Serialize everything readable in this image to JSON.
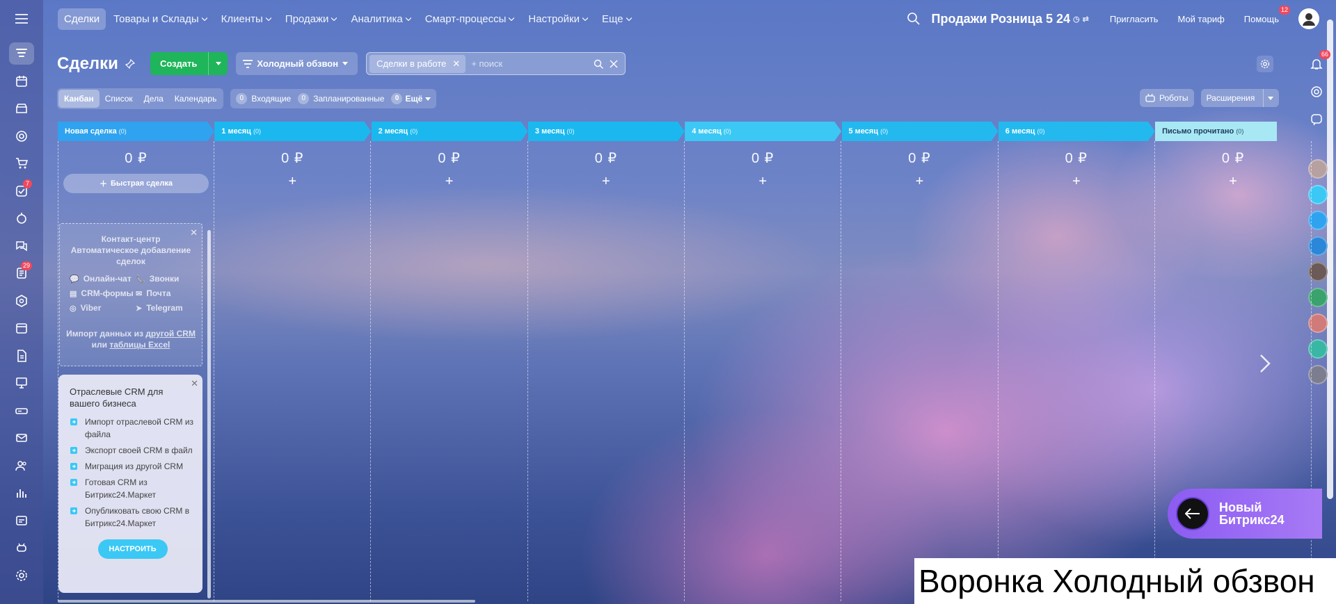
{
  "topnav": {
    "items": [
      {
        "label": "Сделки",
        "active": true,
        "dropdown": false
      },
      {
        "label": "Товары и Склады",
        "active": false,
        "dropdown": true
      },
      {
        "label": "Клиенты",
        "active": false,
        "dropdown": true
      },
      {
        "label": "Продажи",
        "active": false,
        "dropdown": true
      },
      {
        "label": "Аналитика",
        "active": false,
        "dropdown": true
      },
      {
        "label": "Смарт-процессы",
        "active": false,
        "dropdown": true
      },
      {
        "label": "Настройки",
        "active": false,
        "dropdown": true
      },
      {
        "label": "Еще",
        "active": false,
        "dropdown": true
      }
    ]
  },
  "header": {
    "portal_name": "Продажи Розница 5 24",
    "invite": "Пригласить",
    "tariff": "Мой тариф",
    "help": "Помощь",
    "help_badge": "12"
  },
  "sidebar": {
    "badges": {
      "tasks": "7",
      "feed": "29"
    }
  },
  "rightbar": {
    "notifications_badge": "66"
  },
  "page": {
    "title": "Сделки",
    "create": "Создать",
    "funnel": "Холодный обзвон",
    "filter_tag": "Сделки в работе",
    "search_placeholder": "+ поиск"
  },
  "views": {
    "tabs": [
      "Канбан",
      "Список",
      "Дела",
      "Календарь"
    ],
    "counters": [
      {
        "n": "0",
        "label": "Входящие"
      },
      {
        "n": "0",
        "label": "Запланированные"
      },
      {
        "n": "0",
        "label": "Ещё"
      }
    ],
    "robots": "Роботы",
    "extensions": "Расширения"
  },
  "columns": [
    {
      "title": "Новая сделка",
      "count": "(0)",
      "sum": "0 ₽",
      "color": "#2fa3ef"
    },
    {
      "title": "1 месяц",
      "count": "(0)",
      "sum": "0 ₽",
      "color": "#1bb8f0"
    },
    {
      "title": "2 месяц",
      "count": "(0)",
      "sum": "0 ₽",
      "color": "#1bb8f0"
    },
    {
      "title": "3 месяц",
      "count": "(0)",
      "sum": "0 ₽",
      "color": "#1bb8f0"
    },
    {
      "title": "4 месяц",
      "count": "(0)",
      "sum": "0 ₽",
      "color": "#3cc8f4"
    },
    {
      "title": "5 месяц",
      "count": "(0)",
      "sum": "0 ₽",
      "color": "#23b9ef"
    },
    {
      "title": "6 месяц",
      "count": "(0)",
      "sum": "0 ₽",
      "color": "#23b9ef"
    },
    {
      "title": "Письмо прочитано",
      "count": "(0)",
      "sum": "0 ₽",
      "color": "#a8e8f4"
    }
  ],
  "quick_deal": "Быстрая сделка",
  "contact_center": {
    "title": "Контакт-центр Автоматическое добавление сделок",
    "items": [
      "Онлайн-чат",
      "Звонки",
      "CRM-формы",
      "Почта",
      "Viber",
      "Telegram"
    ],
    "import_prefix": "Импорт данных из",
    "import_link1": "другой CRM",
    "import_or": "или",
    "import_link2": "таблицы Excel"
  },
  "industry_card": {
    "title": "Отраслевые CRM для вашего бизнеса",
    "items": [
      "Импорт отраслевой CRM из файла",
      "Экспорт своей CRM в файл",
      "Миграция из другой CRM",
      "Готовая CRM из Битрикс24.Маркет",
      "Опубликовать свою CRM в Битрикс24.Маркет"
    ],
    "button": "НАСТРОИТЬ"
  },
  "new_b24": {
    "line1": "Новый",
    "line2": "Битрикс24"
  },
  "caption": "Воронка Холодный обзвон",
  "colors": {
    "create_green": "#1fb55a",
    "accent_blue": "#3bc8f5",
    "badge_red": "#f2485c",
    "promo_purple": "#8c5cf2"
  }
}
